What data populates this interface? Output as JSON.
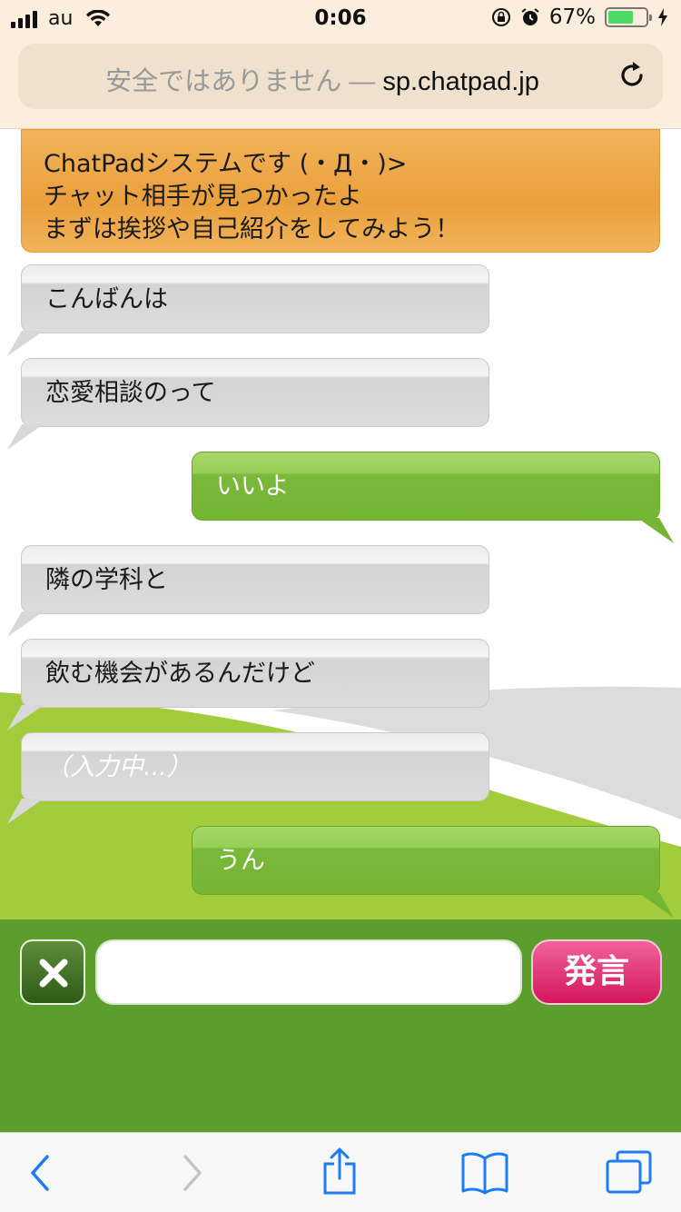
{
  "status_bar": {
    "carrier": "au",
    "time": "0:06",
    "battery_percent": "67%",
    "battery_level": 0.67
  },
  "browser": {
    "url_prefix": "安全ではありません — ",
    "url_host": "sp.chatpad.jp"
  },
  "chat": {
    "system_message": {
      "line1": "ChatPadシステムです (・Д・)>",
      "line2": "チャット相手が見つかったよ",
      "line3": "まずは挨拶や自己紹介をしてみよう！"
    },
    "messages": [
      {
        "side": "left",
        "text": "こんばんは"
      },
      {
        "side": "left",
        "text": "恋愛相談のって"
      },
      {
        "side": "right",
        "text": "いいよ"
      },
      {
        "side": "left",
        "text": "隣の学科と"
      },
      {
        "side": "left",
        "text": "飲む機会があるんだけど"
      },
      {
        "side": "left",
        "text": "（入力中...）"
      },
      {
        "side": "right",
        "text": "うん"
      }
    ]
  },
  "input_bar": {
    "input_value": "",
    "send_label": "発言"
  },
  "colors": {
    "system_orange": "#eaa03c",
    "partner_bubble": "#d8d8d8",
    "own_bubble": "#79b83a",
    "input_bar_green": "#5c9e2e",
    "send_pink": "#d3175c",
    "ios_blue": "#1b7cf5"
  },
  "icons": [
    "signal-icon",
    "wifi-icon",
    "orientation-lock-icon",
    "alarm-icon",
    "battery-icon",
    "charging-icon",
    "reload-icon",
    "clear-icon",
    "back-icon",
    "forward-icon",
    "share-icon",
    "bookmarks-icon",
    "tabs-icon"
  ]
}
